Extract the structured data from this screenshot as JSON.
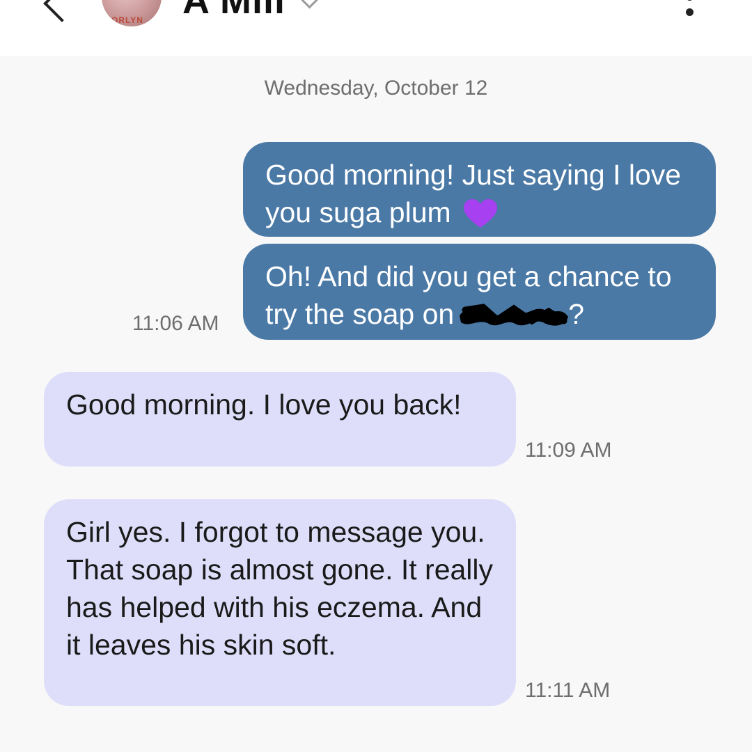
{
  "header": {
    "contact_name": "A Mill",
    "avatar_text": "ORLYN"
  },
  "conversation": {
    "date_separator": "Wednesday, October 12",
    "messages": [
      {
        "direction": "outgoing",
        "text": "Good morning! Just saying I love you suga plum",
        "emoji": "purple-heart"
      },
      {
        "direction": "outgoing",
        "text_before": "Oh! And did you get a chance to try the soap on",
        "redacted": true,
        "text_after": "?",
        "time": "11:06 AM"
      },
      {
        "direction": "incoming",
        "text": "Good morning. I love you back!",
        "time": "11:09 AM"
      },
      {
        "direction": "incoming",
        "text": "Girl yes. I forgot to message you. That soap is almost gone. It really has helped with his eczema. And it leaves his skin soft.",
        "time": "11:11 AM"
      }
    ]
  },
  "colors": {
    "outgoing_bubble": "#4a79a6",
    "incoming_bubble": "#dedefa",
    "background": "#f8f8f8",
    "heart": "#a640f0"
  }
}
